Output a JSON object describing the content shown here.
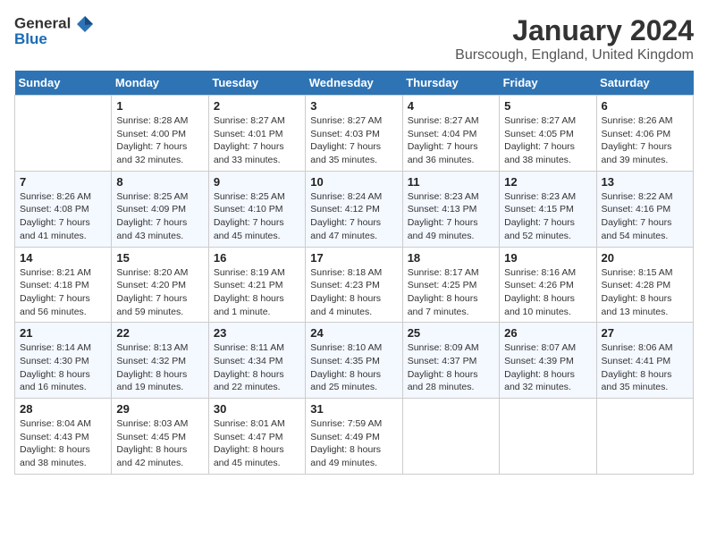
{
  "logo": {
    "general": "General",
    "blue": "Blue"
  },
  "title": "January 2024",
  "location": "Burscough, England, United Kingdom",
  "weekdays": [
    "Sunday",
    "Monday",
    "Tuesday",
    "Wednesday",
    "Thursday",
    "Friday",
    "Saturday"
  ],
  "weeks": [
    [
      {
        "day": "",
        "sunrise": "",
        "sunset": "",
        "daylight": ""
      },
      {
        "day": "1",
        "sunrise": "Sunrise: 8:28 AM",
        "sunset": "Sunset: 4:00 PM",
        "daylight": "Daylight: 7 hours and 32 minutes."
      },
      {
        "day": "2",
        "sunrise": "Sunrise: 8:27 AM",
        "sunset": "Sunset: 4:01 PM",
        "daylight": "Daylight: 7 hours and 33 minutes."
      },
      {
        "day": "3",
        "sunrise": "Sunrise: 8:27 AM",
        "sunset": "Sunset: 4:03 PM",
        "daylight": "Daylight: 7 hours and 35 minutes."
      },
      {
        "day": "4",
        "sunrise": "Sunrise: 8:27 AM",
        "sunset": "Sunset: 4:04 PM",
        "daylight": "Daylight: 7 hours and 36 minutes."
      },
      {
        "day": "5",
        "sunrise": "Sunrise: 8:27 AM",
        "sunset": "Sunset: 4:05 PM",
        "daylight": "Daylight: 7 hours and 38 minutes."
      },
      {
        "day": "6",
        "sunrise": "Sunrise: 8:26 AM",
        "sunset": "Sunset: 4:06 PM",
        "daylight": "Daylight: 7 hours and 39 minutes."
      }
    ],
    [
      {
        "day": "7",
        "sunrise": "Sunrise: 8:26 AM",
        "sunset": "Sunset: 4:08 PM",
        "daylight": "Daylight: 7 hours and 41 minutes."
      },
      {
        "day": "8",
        "sunrise": "Sunrise: 8:25 AM",
        "sunset": "Sunset: 4:09 PM",
        "daylight": "Daylight: 7 hours and 43 minutes."
      },
      {
        "day": "9",
        "sunrise": "Sunrise: 8:25 AM",
        "sunset": "Sunset: 4:10 PM",
        "daylight": "Daylight: 7 hours and 45 minutes."
      },
      {
        "day": "10",
        "sunrise": "Sunrise: 8:24 AM",
        "sunset": "Sunset: 4:12 PM",
        "daylight": "Daylight: 7 hours and 47 minutes."
      },
      {
        "day": "11",
        "sunrise": "Sunrise: 8:23 AM",
        "sunset": "Sunset: 4:13 PM",
        "daylight": "Daylight: 7 hours and 49 minutes."
      },
      {
        "day": "12",
        "sunrise": "Sunrise: 8:23 AM",
        "sunset": "Sunset: 4:15 PM",
        "daylight": "Daylight: 7 hours and 52 minutes."
      },
      {
        "day": "13",
        "sunrise": "Sunrise: 8:22 AM",
        "sunset": "Sunset: 4:16 PM",
        "daylight": "Daylight: 7 hours and 54 minutes."
      }
    ],
    [
      {
        "day": "14",
        "sunrise": "Sunrise: 8:21 AM",
        "sunset": "Sunset: 4:18 PM",
        "daylight": "Daylight: 7 hours and 56 minutes."
      },
      {
        "day": "15",
        "sunrise": "Sunrise: 8:20 AM",
        "sunset": "Sunset: 4:20 PM",
        "daylight": "Daylight: 7 hours and 59 minutes."
      },
      {
        "day": "16",
        "sunrise": "Sunrise: 8:19 AM",
        "sunset": "Sunset: 4:21 PM",
        "daylight": "Daylight: 8 hours and 1 minute."
      },
      {
        "day": "17",
        "sunrise": "Sunrise: 8:18 AM",
        "sunset": "Sunset: 4:23 PM",
        "daylight": "Daylight: 8 hours and 4 minutes."
      },
      {
        "day": "18",
        "sunrise": "Sunrise: 8:17 AM",
        "sunset": "Sunset: 4:25 PM",
        "daylight": "Daylight: 8 hours and 7 minutes."
      },
      {
        "day": "19",
        "sunrise": "Sunrise: 8:16 AM",
        "sunset": "Sunset: 4:26 PM",
        "daylight": "Daylight: 8 hours and 10 minutes."
      },
      {
        "day": "20",
        "sunrise": "Sunrise: 8:15 AM",
        "sunset": "Sunset: 4:28 PM",
        "daylight": "Daylight: 8 hours and 13 minutes."
      }
    ],
    [
      {
        "day": "21",
        "sunrise": "Sunrise: 8:14 AM",
        "sunset": "Sunset: 4:30 PM",
        "daylight": "Daylight: 8 hours and 16 minutes."
      },
      {
        "day": "22",
        "sunrise": "Sunrise: 8:13 AM",
        "sunset": "Sunset: 4:32 PM",
        "daylight": "Daylight: 8 hours and 19 minutes."
      },
      {
        "day": "23",
        "sunrise": "Sunrise: 8:11 AM",
        "sunset": "Sunset: 4:34 PM",
        "daylight": "Daylight: 8 hours and 22 minutes."
      },
      {
        "day": "24",
        "sunrise": "Sunrise: 8:10 AM",
        "sunset": "Sunset: 4:35 PM",
        "daylight": "Daylight: 8 hours and 25 minutes."
      },
      {
        "day": "25",
        "sunrise": "Sunrise: 8:09 AM",
        "sunset": "Sunset: 4:37 PM",
        "daylight": "Daylight: 8 hours and 28 minutes."
      },
      {
        "day": "26",
        "sunrise": "Sunrise: 8:07 AM",
        "sunset": "Sunset: 4:39 PM",
        "daylight": "Daylight: 8 hours and 32 minutes."
      },
      {
        "day": "27",
        "sunrise": "Sunrise: 8:06 AM",
        "sunset": "Sunset: 4:41 PM",
        "daylight": "Daylight: 8 hours and 35 minutes."
      }
    ],
    [
      {
        "day": "28",
        "sunrise": "Sunrise: 8:04 AM",
        "sunset": "Sunset: 4:43 PM",
        "daylight": "Daylight: 8 hours and 38 minutes."
      },
      {
        "day": "29",
        "sunrise": "Sunrise: 8:03 AM",
        "sunset": "Sunset: 4:45 PM",
        "daylight": "Daylight: 8 hours and 42 minutes."
      },
      {
        "day": "30",
        "sunrise": "Sunrise: 8:01 AM",
        "sunset": "Sunset: 4:47 PM",
        "daylight": "Daylight: 8 hours and 45 minutes."
      },
      {
        "day": "31",
        "sunrise": "Sunrise: 7:59 AM",
        "sunset": "Sunset: 4:49 PM",
        "daylight": "Daylight: 8 hours and 49 minutes."
      },
      {
        "day": "",
        "sunrise": "",
        "sunset": "",
        "daylight": ""
      },
      {
        "day": "",
        "sunrise": "",
        "sunset": "",
        "daylight": ""
      },
      {
        "day": "",
        "sunrise": "",
        "sunset": "",
        "daylight": ""
      }
    ]
  ]
}
